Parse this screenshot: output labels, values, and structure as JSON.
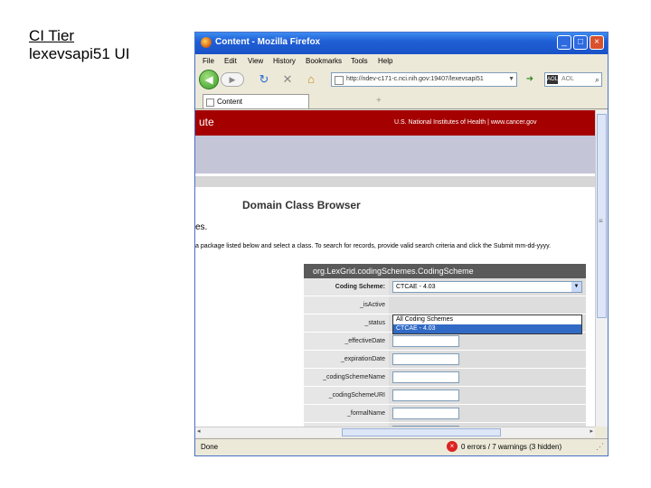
{
  "slide": {
    "line1": "CI Tier",
    "line2": "lexevsapi51 UI"
  },
  "window": {
    "title": "Content - Mozilla Firefox",
    "controls": {
      "minimize": "_",
      "maximize": "□",
      "close": "×"
    }
  },
  "menu": [
    "File",
    "Edit",
    "View",
    "History",
    "Bookmarks",
    "Tools",
    "Help"
  ],
  "nav": {
    "back": "◀",
    "forward": "▶",
    "reload": "↻",
    "stop": "✕",
    "home": "⌂",
    "url": "http://ndev-c171-c.nci.nih.gov:19407/lexevsapi51",
    "search_placeholder": "AOL",
    "search_badge": "AOL"
  },
  "tabs": {
    "label": "Content",
    "new_tab": "+"
  },
  "page": {
    "banner_left": "ute",
    "banner_right": "U.S. National Institutes of Health  |  www.cancer.gov",
    "heading": "Domain Class Browser",
    "es": "es.",
    "instructions": "a package listed below and select a class. To search for records, provide valid search criteria and click the Submit mm-dd-yyyy."
  },
  "panel": {
    "header": "org.LexGrid.codingSchemes.CodingScheme",
    "select_label": "Coding Scheme:",
    "select_value": "CTCAE - 4.03",
    "dropdown_options": [
      "All Coding Schemes",
      "CTCAE - 4.03"
    ],
    "rows": [
      "_isActive",
      "_status",
      "_effectiveDate",
      "_expirationDate",
      "_codingSchemeName",
      "_codingSchemeURI",
      "_formalName"
    ]
  },
  "status": {
    "done": "Done",
    "errors": "0 errors / 7 warnings (3 hidden)"
  }
}
